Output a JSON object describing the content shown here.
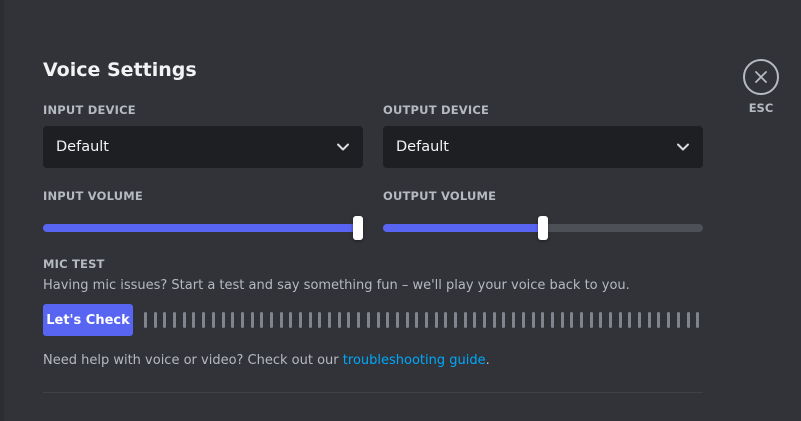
{
  "page": {
    "title": "Voice Settings",
    "close_label": "ESC"
  },
  "input_device": {
    "label": "INPUT DEVICE",
    "value": "Default"
  },
  "output_device": {
    "label": "OUTPUT DEVICE",
    "value": "Default"
  },
  "input_volume": {
    "label": "INPUT VOLUME",
    "level_percent": 100
  },
  "output_volume": {
    "label": "OUTPUT VOLUME",
    "level_percent": 50
  },
  "mic_test": {
    "label": "MIC TEST",
    "description": "Having mic issues? Start a test and say something fun – we'll play your voice back to you.",
    "button_label": "Let's Check",
    "meter_segments": 58
  },
  "help": {
    "text": "Need help with voice or video? Check out our ",
    "link_text": "troubleshooting guide",
    "suffix": "."
  },
  "icons": {
    "close": "close-icon",
    "dropdown": "chevron-down-icon"
  },
  "colors": {
    "background": "#313338",
    "input_bg": "#1e1f22",
    "accent": "#5865f2",
    "link": "#00a8fc",
    "track": "#4e5058"
  }
}
